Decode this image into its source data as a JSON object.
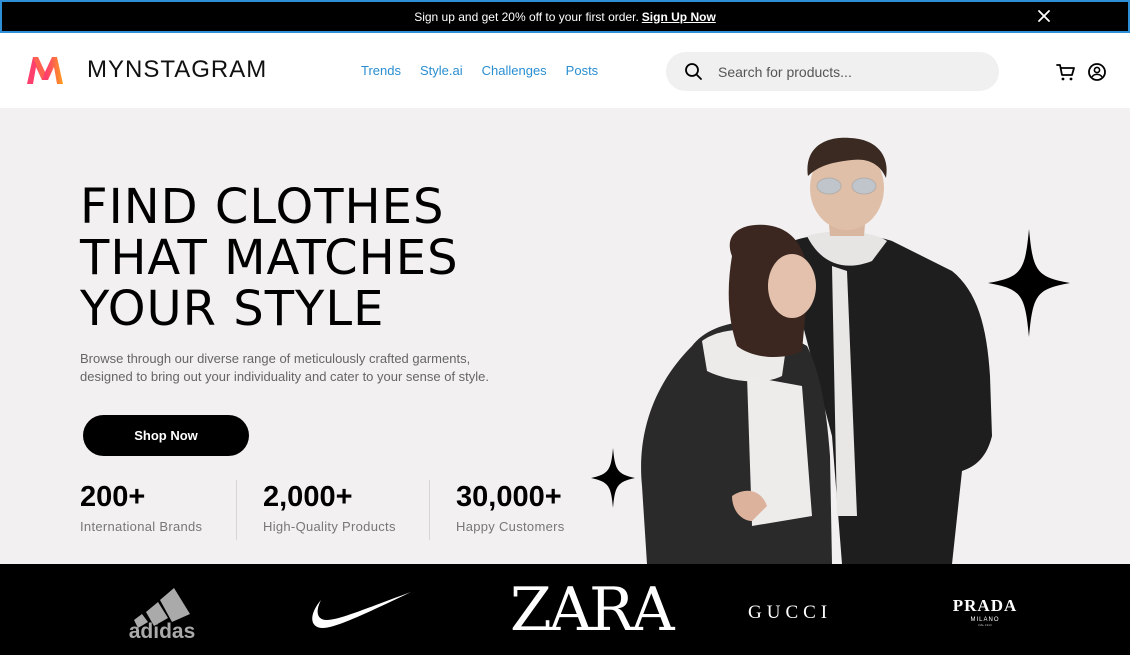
{
  "promo": {
    "text": "Sign up and get 20% off to your first order.",
    "link": "Sign Up Now"
  },
  "header": {
    "brand": "MYNSTAGRAM",
    "nav": [
      "Trends",
      "Style.ai",
      "Challenges",
      "Posts"
    ],
    "search_placeholder": "Search for products..."
  },
  "hero": {
    "headline": [
      "FIND CLOTHES",
      "THAT MATCHES",
      "YOUR STYLE"
    ],
    "description": "Browse through our diverse range of meticulously crafted garments, designed to bring out your individuality and cater to your sense of style.",
    "cta": "Shop Now",
    "stats": [
      {
        "value": "200+",
        "label": "International Brands"
      },
      {
        "value": "2,000+",
        "label": "High-Quality Products"
      },
      {
        "value": "30,000+",
        "label": "Happy Customers"
      }
    ]
  },
  "brands": {
    "logos": [
      "adidas-logo",
      "nike-logo",
      "zara-logo",
      "gucci-logo",
      "prada-logo"
    ],
    "adidas": "adidas",
    "zara": "ZARA",
    "gucci": "GUCCI",
    "prada": "PRADA",
    "prada_sub": "MILANO",
    "prada_since": "DAL 1913"
  },
  "colors": {
    "nav_link": "#2a8ed0",
    "hero_bg": "#f2f0f1",
    "promo_border": "#2f8fd6",
    "logo_gradient": [
      "#ff3f6c",
      "#ff9f1c"
    ]
  }
}
